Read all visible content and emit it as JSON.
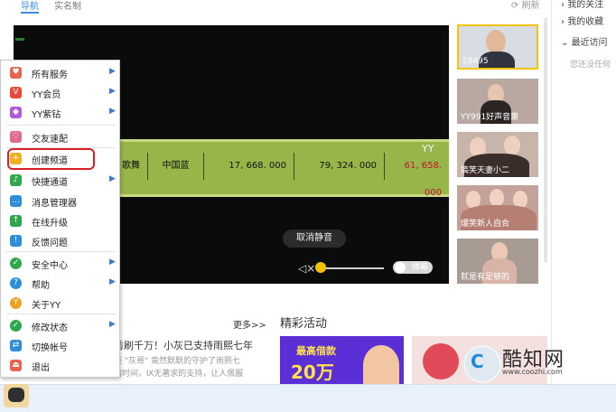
{
  "top_bar": {
    "nav_tab": "导航",
    "realname_tab": "实名制",
    "refresh": "刷新"
  },
  "right_panel": {
    "top_cut_item": "我的关注",
    "favorites": "我的收藏",
    "recent_visits": "最近访问",
    "recent_hint": "您还没任何"
  },
  "player": {
    "table_cells": [
      "歌舞",
      "中国蓝",
      "17, 668. 000",
      "79, 324. 000",
      "61, 658. 000"
    ],
    "watermark": "YY",
    "unmute_button": "取消静音",
    "danmu_toggle": "弹幕",
    "volume_level": 0.0
  },
  "thumbnails": [
    {
      "label": "28495",
      "selected": true
    },
    {
      "label": "YY991好声音蕙"
    },
    {
      "label": "搞笑天妻小二"
    },
    {
      "label": "爆笑新人自合"
    },
    {
      "label": "就是有足够的"
    }
  ],
  "content": {
    "more_link": "更多>>",
    "activity_title": "精彩活动",
    "news_headline": "秀刷千万！小灰已支持雨熙七年",
    "news_desc_1": "豪 \"灰哥\" 竟然默默的守护了雨熙七",
    "news_desc_2": "的时间，Ⅸ无著求的支持，让人佩服",
    "promo_text_1": "最高借款",
    "promo_text_2": "20万"
  },
  "watermark_logo": {
    "name": "酷知网",
    "url": "www.coozhi.com"
  },
  "menu": {
    "items": [
      {
        "label": "所有服务",
        "icon": "heart-icon",
        "color": "#e8644c",
        "arrow": true
      },
      {
        "label": "YY会员",
        "icon": "vip-icon",
        "color": "#e84a3a",
        "arrow": true
      },
      {
        "label": "YY紫钻",
        "icon": "diamond-icon",
        "color": "#b05ad8",
        "arrow": true
      },
      {
        "label": "交友速配",
        "icon": "heart-match-icon",
        "color": "#e06a8a",
        "arrow": false
      },
      {
        "label": "创建频道",
        "icon": "plus-icon",
        "color": "#f0b020",
        "arrow": false
      },
      {
        "label": "快捷通道",
        "icon": "bell-icon",
        "color": "#2ea84a",
        "arrow": true
      },
      {
        "label": "消息管理器",
        "icon": "message-icon",
        "color": "#2e8fd8",
        "arrow": false
      },
      {
        "label": "在线升级",
        "icon": "upgrade-icon",
        "color": "#2ea84a",
        "arrow": false
      },
      {
        "label": "反馈问题",
        "icon": "feedback-icon",
        "color": "#2e8fd8",
        "arrow": false
      },
      {
        "label": "安全中心",
        "icon": "shield-icon",
        "color": "#2ea84a",
        "arrow": true
      },
      {
        "label": "帮助",
        "icon": "help-icon",
        "color": "#2e8fd8",
        "arrow": true
      },
      {
        "label": "关于YY",
        "icon": "about-icon",
        "color": "#f0a020",
        "arrow": false
      },
      {
        "label": "修改状态",
        "icon": "status-icon",
        "color": "#2ea84a",
        "arrow": true
      },
      {
        "label": "切换帐号",
        "icon": "switch-icon",
        "color": "#2e8fd8",
        "arrow": false
      },
      {
        "label": "退出",
        "icon": "exit-icon",
        "color": "#e8644c",
        "arrow": false
      }
    ],
    "highlighted_item": "创建频道"
  }
}
